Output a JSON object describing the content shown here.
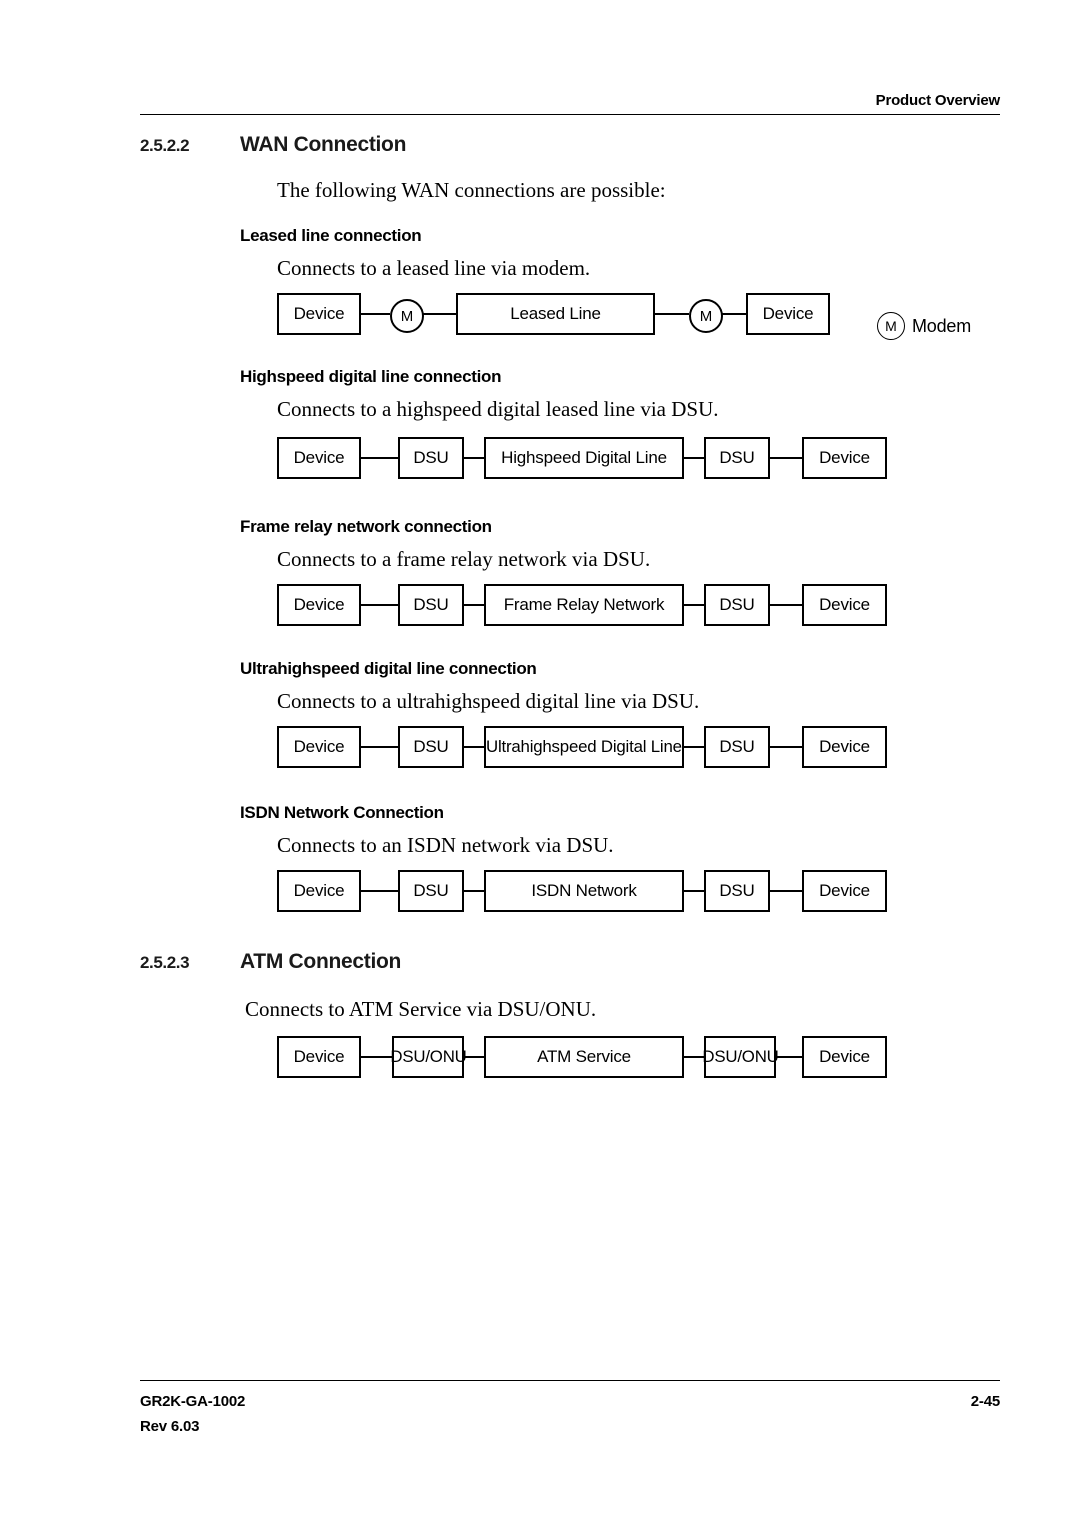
{
  "header": {
    "title": "Product Overview"
  },
  "sections": [
    {
      "number": "2.5.2.2",
      "title": "WAN Connection",
      "intro": "The following WAN connections are possible:"
    },
    {
      "number": "2.5.2.3",
      "title": "ATM Connection",
      "intro": "Connects to ATM Service via DSU/ONU."
    }
  ],
  "subsections": [
    {
      "heading": "Leased line connection",
      "body": "Connects to a leased line via modem."
    },
    {
      "heading": "Highspeed digital line connection",
      "body": "Connects to a highspeed digital leased line via DSU."
    },
    {
      "heading": "Frame relay network connection",
      "body": "Connects to a frame relay network via DSU."
    },
    {
      "heading": "Ultrahighspeed digital line connection",
      "body": "Connects to a ultrahighspeed digital line via DSU."
    },
    {
      "heading": "ISDN Network Connection",
      "body": "Connects to an ISDN network via DSU."
    }
  ],
  "diagrams": {
    "leased_line": {
      "left_device": "Device",
      "left_node": "M",
      "middle": "Leased Line",
      "right_node": "M",
      "right_device": "Device"
    },
    "highspeed": {
      "left_device": "Device",
      "left_node": "DSU",
      "middle": "Highspeed Digital Line",
      "right_node": "DSU",
      "right_device": "Device"
    },
    "frame_relay": {
      "left_device": "Device",
      "left_node": "DSU",
      "middle": "Frame Relay Network",
      "right_node": "DSU",
      "right_device": "Device"
    },
    "ultrahighspeed": {
      "left_device": "Device",
      "left_node": "DSU",
      "middle": "Ultrahighspeed Digital Line",
      "right_node": "DSU",
      "right_device": "Device"
    },
    "isdn": {
      "left_device": "Device",
      "left_node": "DSU",
      "middle": "ISDN Network",
      "right_node": "DSU",
      "right_device": "Device"
    },
    "atm": {
      "left_device": "Device",
      "left_node": "DSU/ONU",
      "middle": "ATM Service",
      "right_node": "DSU/ONU",
      "right_device": "Device"
    }
  },
  "legend": {
    "symbol": "M",
    "label": "Modem"
  },
  "footer": {
    "doc_id": "GR2K-GA-1002",
    "revision": "Rev 6.03",
    "page_number": "2-45"
  }
}
